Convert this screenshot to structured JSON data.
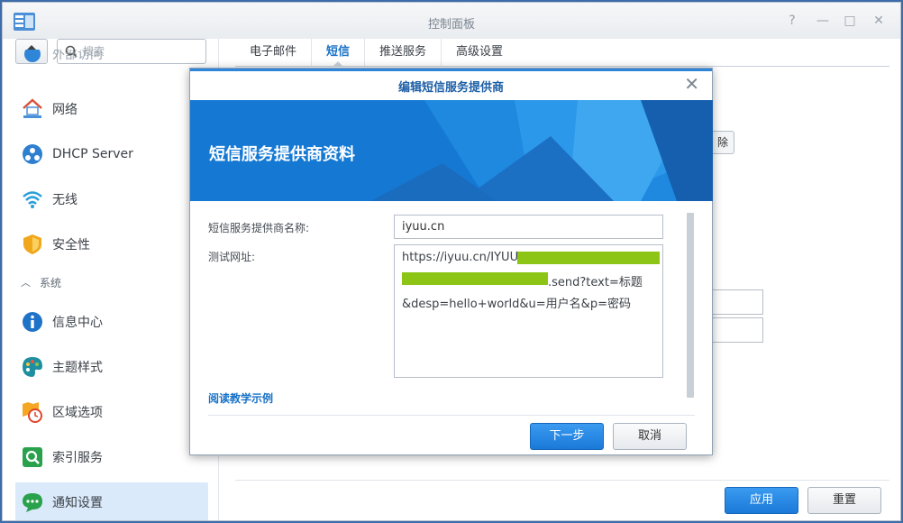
{
  "window": {
    "title": "控制面板",
    "controls": [
      "?",
      "—",
      "□",
      "✕"
    ]
  },
  "search": {
    "placeholder": "搜索"
  },
  "sidebar": {
    "partial_item_label": "外部访问",
    "items": [
      {
        "label": "网络",
        "icon": "house-network-icon"
      },
      {
        "label": "DHCP Server",
        "icon": "dhcp-icon"
      },
      {
        "label": "无线",
        "icon": "wifi-icon"
      },
      {
        "label": "安全性",
        "icon": "shield-icon"
      }
    ],
    "section": "系统",
    "system_items": [
      {
        "label": "信息中心",
        "icon": "info-icon"
      },
      {
        "label": "主题样式",
        "icon": "palette-icon"
      },
      {
        "label": "区域选项",
        "icon": "map-clock-icon"
      },
      {
        "label": "索引服务",
        "icon": "index-search-icon"
      },
      {
        "label": "通知设置",
        "icon": "chat-bubble-icon",
        "selected": true
      }
    ]
  },
  "tabs": [
    {
      "label": "电子邮件"
    },
    {
      "label": "短信",
      "active": true
    },
    {
      "label": "推送服务"
    },
    {
      "label": "高级设置"
    }
  ],
  "background": {
    "partial_button": "除",
    "apply": "应用",
    "reset": "重置"
  },
  "modal": {
    "title": "编辑短信服务提供商",
    "banner_title": "短信服务提供商资料",
    "provider_label": "短信服务提供商名称:",
    "provider_value": "iyuu.cn",
    "url_label": "测试网址:",
    "url_line1": "https://iyuu.cn/IYUU",
    "url_line2_suffix": ".send?text=标题",
    "url_line3": "&desp=hello+world&u=用户名&p=密码",
    "link": "阅读教学示例",
    "next": "下一步",
    "cancel": "取消",
    "colors": {
      "accent": "#1a72c7",
      "redaction": "#8dc517"
    }
  }
}
